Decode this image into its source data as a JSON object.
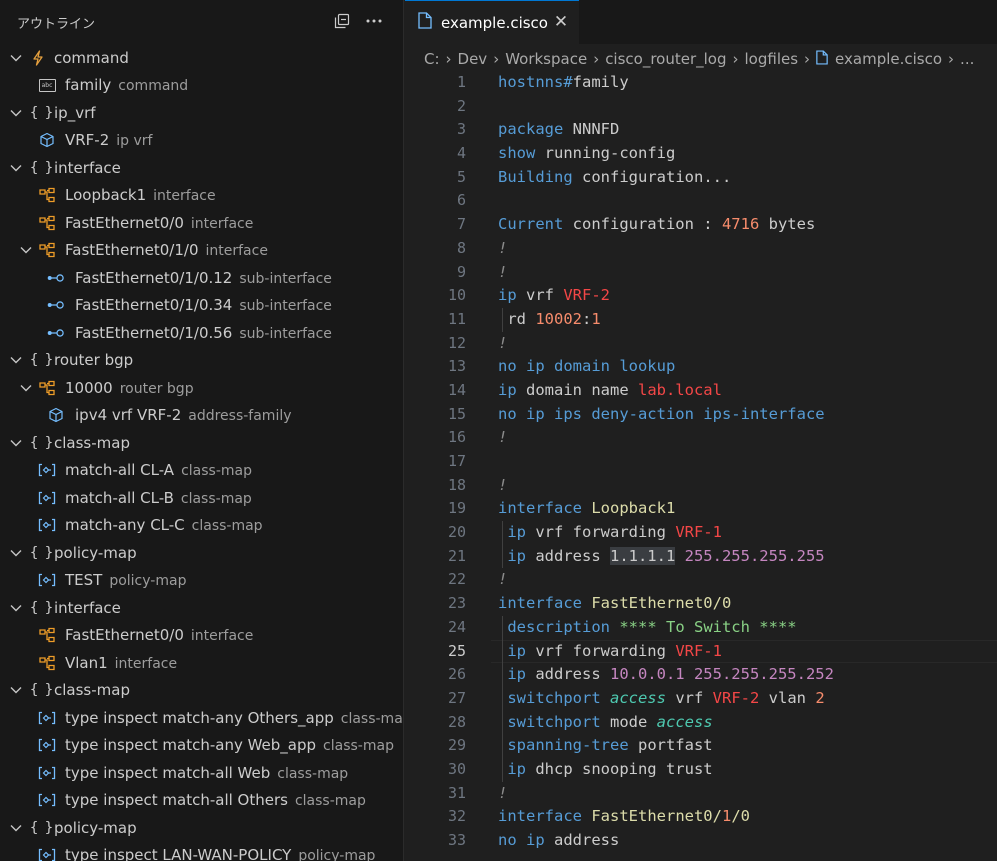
{
  "outline": {
    "title": "アウトライン",
    "items": [
      {
        "label": "command",
        "desc": "",
        "icon": "event-icon",
        "iconChar": "⚡",
        "iconColor": "#e5a03e",
        "chev": "open",
        "indent": 0
      },
      {
        "label": "family",
        "desc": "command",
        "icon": "string-icon",
        "iconChar": "abc",
        "iconColor": "#c5c5c5",
        "chev": "none",
        "indent": 1
      },
      {
        "label": "ip_vrf",
        "desc": "",
        "icon": "namespace-icon",
        "iconChar": "{}",
        "iconColor": "#cccccc",
        "chev": "open",
        "indent": 0
      },
      {
        "label": "VRF-2",
        "desc": "ip vrf",
        "icon": "module-icon",
        "iconChar": "⬡",
        "iconColor": "#75beff",
        "chev": "none",
        "indent": 1
      },
      {
        "label": "interface",
        "desc": "",
        "icon": "namespace-icon",
        "iconChar": "{}",
        "iconColor": "#cccccc",
        "chev": "open",
        "indent": 0
      },
      {
        "label": "Loopback1",
        "desc": "interface",
        "icon": "class-icon",
        "iconChar": "⧉",
        "iconColor": "#ee9d28",
        "chev": "none",
        "indent": 1
      },
      {
        "label": "FastEthernet0/0",
        "desc": "interface",
        "icon": "class-icon",
        "iconChar": "⧉",
        "iconColor": "#ee9d28",
        "chev": "none",
        "indent": 1
      },
      {
        "label": "FastEthernet0/1/0",
        "desc": "interface",
        "icon": "class-icon",
        "iconChar": "⧉",
        "iconColor": "#ee9d28",
        "chev": "open",
        "indent": 1
      },
      {
        "label": "FastEthernet0/1/0.12",
        "desc": "sub-interface",
        "icon": "interface-icon",
        "iconChar": "•-○",
        "iconColor": "#75beff",
        "chev": "none",
        "indent": 2
      },
      {
        "label": "FastEthernet0/1/0.34",
        "desc": "sub-interface",
        "icon": "interface-icon",
        "iconChar": "•-○",
        "iconColor": "#75beff",
        "chev": "none",
        "indent": 2
      },
      {
        "label": "FastEthernet0/1/0.56",
        "desc": "sub-interface",
        "icon": "interface-icon",
        "iconChar": "•-○",
        "iconColor": "#75beff",
        "chev": "none",
        "indent": 2
      },
      {
        "label": "router bgp",
        "desc": "",
        "icon": "namespace-icon",
        "iconChar": "{}",
        "iconColor": "#cccccc",
        "chev": "open",
        "indent": 0
      },
      {
        "label": "10000",
        "desc": "router bgp",
        "icon": "class-icon",
        "iconChar": "⧉",
        "iconColor": "#ee9d28",
        "chev": "open",
        "indent": 1
      },
      {
        "label": "ipv4 vrf VRF-2",
        "desc": "address-family",
        "icon": "module-icon",
        "iconChar": "⬡",
        "iconColor": "#75beff",
        "chev": "none",
        "indent": 2
      },
      {
        "label": "class-map",
        "desc": "",
        "icon": "namespace-icon",
        "iconChar": "{}",
        "iconColor": "#cccccc",
        "chev": "open",
        "indent": 0
      },
      {
        "label": "match-all CL-A",
        "desc": "class-map",
        "icon": "enum-icon",
        "iconChar": "[≡]",
        "iconColor": "#75beff",
        "chev": "none",
        "indent": 1
      },
      {
        "label": "match-all CL-B",
        "desc": "class-map",
        "icon": "enum-icon",
        "iconChar": "[≡]",
        "iconColor": "#75beff",
        "chev": "none",
        "indent": 1
      },
      {
        "label": "match-any CL-C",
        "desc": "class-map",
        "icon": "enum-icon",
        "iconChar": "[≡]",
        "iconColor": "#75beff",
        "chev": "none",
        "indent": 1
      },
      {
        "label": "policy-map",
        "desc": "",
        "icon": "namespace-icon",
        "iconChar": "{}",
        "iconColor": "#cccccc",
        "chev": "open",
        "indent": 0
      },
      {
        "label": "TEST",
        "desc": "policy-map",
        "icon": "enum-icon",
        "iconChar": "[≡]",
        "iconColor": "#75beff",
        "chev": "none",
        "indent": 1
      },
      {
        "label": "interface",
        "desc": "",
        "icon": "namespace-icon",
        "iconChar": "{}",
        "iconColor": "#cccccc",
        "chev": "open",
        "indent": 0
      },
      {
        "label": "FastEthernet0/0",
        "desc": "interface",
        "icon": "class-icon",
        "iconChar": "⧉",
        "iconColor": "#ee9d28",
        "chev": "none",
        "indent": 1
      },
      {
        "label": "Vlan1",
        "desc": "interface",
        "icon": "class-icon",
        "iconChar": "⧉",
        "iconColor": "#ee9d28",
        "chev": "none",
        "indent": 1
      },
      {
        "label": "class-map",
        "desc": "",
        "icon": "namespace-icon",
        "iconChar": "{}",
        "iconColor": "#cccccc",
        "chev": "open",
        "indent": 0
      },
      {
        "label": "type inspect match-any Others_app",
        "desc": "class-map",
        "icon": "enum-icon",
        "iconChar": "[≡]",
        "iconColor": "#75beff",
        "chev": "none",
        "indent": 1
      },
      {
        "label": "type inspect match-any Web_app",
        "desc": "class-map",
        "icon": "enum-icon",
        "iconChar": "[≡]",
        "iconColor": "#75beff",
        "chev": "none",
        "indent": 1
      },
      {
        "label": "type inspect match-all Web",
        "desc": "class-map",
        "icon": "enum-icon",
        "iconChar": "[≡]",
        "iconColor": "#75beff",
        "chev": "none",
        "indent": 1
      },
      {
        "label": "type inspect match-all Others",
        "desc": "class-map",
        "icon": "enum-icon",
        "iconChar": "[≡]",
        "iconColor": "#75beff",
        "chev": "none",
        "indent": 1
      },
      {
        "label": "policy-map",
        "desc": "",
        "icon": "namespace-icon",
        "iconChar": "{}",
        "iconColor": "#cccccc",
        "chev": "open",
        "indent": 0
      },
      {
        "label": "type inspect LAN-WAN-POLICY",
        "desc": "policy-map",
        "icon": "enum-icon",
        "iconChar": "[≡]",
        "iconColor": "#75beff",
        "chev": "none",
        "indent": 1
      }
    ]
  },
  "tab": {
    "label": "example.cisco",
    "close": "✕"
  },
  "breadcrumb": {
    "items": [
      "C:",
      "Dev",
      "Workspace",
      "cisco_router_log",
      "logfiles"
    ],
    "file": "example.cisco",
    "more": "..."
  },
  "editor": {
    "current_line": 25,
    "lines": [
      {
        "n": 1,
        "guide": false,
        "tokens": [
          [
            "k",
            "hostnns#"
          ],
          [
            "i",
            "family"
          ]
        ]
      },
      {
        "n": 2,
        "guide": false,
        "tokens": []
      },
      {
        "n": 3,
        "guide": false,
        "tokens": [
          [
            "k",
            "package "
          ],
          [
            "i",
            "NNNFD"
          ]
        ]
      },
      {
        "n": 4,
        "guide": false,
        "tokens": [
          [
            "k",
            "show "
          ],
          [
            "i",
            "running-config"
          ]
        ]
      },
      {
        "n": 5,
        "guide": false,
        "tokens": [
          [
            "k",
            "Building "
          ],
          [
            "i",
            "configuration..."
          ]
        ]
      },
      {
        "n": 6,
        "guide": false,
        "tokens": []
      },
      {
        "n": 7,
        "guide": false,
        "tokens": [
          [
            "k",
            "Current "
          ],
          [
            "i",
            "configuration : "
          ],
          [
            "n",
            "4716"
          ],
          [
            "i",
            " bytes"
          ]
        ]
      },
      {
        "n": 8,
        "guide": false,
        "tokens": [
          [
            "c",
            "!"
          ]
        ]
      },
      {
        "n": 9,
        "guide": false,
        "tokens": [
          [
            "c",
            "!"
          ]
        ]
      },
      {
        "n": 10,
        "guide": false,
        "tokens": [
          [
            "k",
            "ip "
          ],
          [
            "i",
            "vrf "
          ],
          [
            "v",
            "VRF-2"
          ]
        ]
      },
      {
        "n": 11,
        "guide": true,
        "tokens": [
          [
            "i",
            " rd "
          ],
          [
            "n",
            "10002"
          ],
          [
            "i",
            ":"
          ],
          [
            "n",
            "1"
          ]
        ]
      },
      {
        "n": 12,
        "guide": false,
        "tokens": [
          [
            "c",
            "!"
          ]
        ]
      },
      {
        "n": 13,
        "guide": false,
        "tokens": [
          [
            "k",
            "no ip domain lookup"
          ]
        ]
      },
      {
        "n": 14,
        "guide": false,
        "tokens": [
          [
            "k",
            "ip "
          ],
          [
            "i",
            "domain name "
          ],
          [
            "v",
            "lab.local"
          ]
        ]
      },
      {
        "n": 15,
        "guide": false,
        "tokens": [
          [
            "k",
            "no ip ips deny-action ips-interface"
          ]
        ]
      },
      {
        "n": 16,
        "guide": false,
        "tokens": [
          [
            "c",
            "!"
          ]
        ]
      },
      {
        "n": 17,
        "guide": false,
        "tokens": []
      },
      {
        "n": 18,
        "guide": false,
        "tokens": [
          [
            "c",
            "!"
          ]
        ]
      },
      {
        "n": 19,
        "guide": false,
        "tokens": [
          [
            "k",
            "interface "
          ],
          [
            "y",
            "Loopback1"
          ]
        ]
      },
      {
        "n": 20,
        "guide": true,
        "tokens": [
          [
            "k",
            " ip "
          ],
          [
            "i",
            "vrf forwarding "
          ],
          [
            "v",
            "VRF-1"
          ]
        ]
      },
      {
        "n": 21,
        "guide": true,
        "tokens": [
          [
            "k",
            " ip "
          ],
          [
            "i",
            "address "
          ],
          [
            "hl",
            "1.1.1.1"
          ],
          [
            "a",
            " 255.255.255.255"
          ]
        ]
      },
      {
        "n": 22,
        "guide": false,
        "tokens": [
          [
            "c",
            "!"
          ]
        ]
      },
      {
        "n": 23,
        "guide": false,
        "tokens": [
          [
            "k",
            "interface "
          ],
          [
            "y",
            "FastEthernet0/0"
          ]
        ]
      },
      {
        "n": 24,
        "guide": true,
        "tokens": [
          [
            "k",
            " description "
          ],
          [
            "gr",
            "**** To Switch ****"
          ]
        ]
      },
      {
        "n": 25,
        "guide": true,
        "tokens": [
          [
            "k",
            " ip "
          ],
          [
            "i",
            "vrf forwarding "
          ],
          [
            "v",
            "VRF-1"
          ]
        ]
      },
      {
        "n": 26,
        "guide": true,
        "tokens": [
          [
            "k",
            " ip "
          ],
          [
            "i",
            "address "
          ],
          [
            "a",
            "10.0.0.1 255.255.255.252"
          ]
        ]
      },
      {
        "n": 27,
        "guide": true,
        "tokens": [
          [
            "k",
            " switchport "
          ],
          [
            "g",
            "access"
          ],
          [
            "i",
            " vrf "
          ],
          [
            "v",
            "VRF-2"
          ],
          [
            "i",
            " vlan "
          ],
          [
            "n",
            "2"
          ]
        ]
      },
      {
        "n": 28,
        "guide": true,
        "tokens": [
          [
            "k",
            " switchport "
          ],
          [
            "i",
            "mode "
          ],
          [
            "g",
            "access"
          ]
        ]
      },
      {
        "n": 29,
        "guide": true,
        "tokens": [
          [
            "k",
            " spanning-tree "
          ],
          [
            "i",
            "portfast"
          ]
        ]
      },
      {
        "n": 30,
        "guide": true,
        "tokens": [
          [
            "k",
            " ip "
          ],
          [
            "i",
            "dhcp snooping trust"
          ]
        ]
      },
      {
        "n": 31,
        "guide": false,
        "tokens": [
          [
            "c",
            "!"
          ]
        ]
      },
      {
        "n": 32,
        "guide": false,
        "tokens": [
          [
            "k",
            "interface "
          ],
          [
            "y",
            "FastEthernet0/"
          ],
          [
            "n",
            "1"
          ],
          [
            "y",
            "/0"
          ]
        ]
      },
      {
        "n": 33,
        "guide": false,
        "tokens": [
          [
            "k",
            "no ip "
          ],
          [
            "i",
            "address"
          ]
        ]
      }
    ]
  }
}
